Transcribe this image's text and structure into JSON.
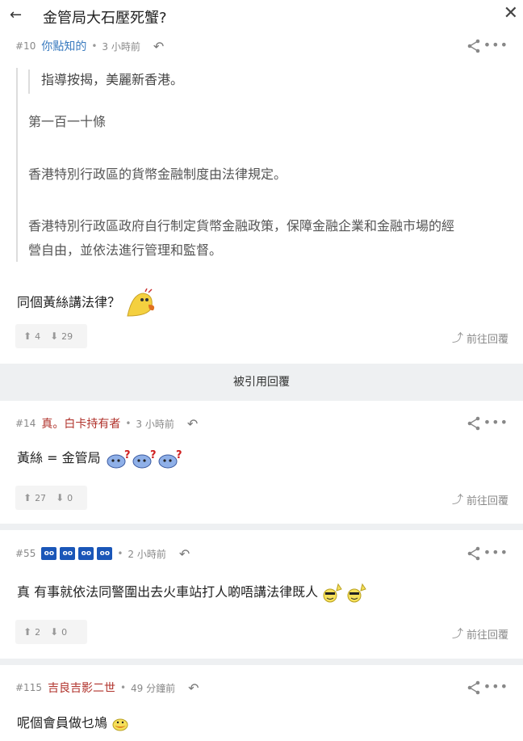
{
  "header": {
    "title": "金管局大石壓死蟹?",
    "back_icon": "arrow-left-icon",
    "close_icon": "close-icon"
  },
  "posts": [
    {
      "number": "#10",
      "user": "你點知的",
      "time": "3 小時前",
      "nested_quote": "指導按揭，美麗新香港。",
      "quote_lines": [
        "第一百一十條",
        "香港特別行政區的貨幣金融制度由法律規定。",
        "香港特別行政區政府自行制定貨幣金融政策，保障金融企業和金融市場的經",
        "營自由，並依法進行管理和監督。"
      ],
      "body": "同個黃絲講法律？",
      "up": "4",
      "down": "29",
      "goto": "前往回覆"
    },
    {
      "number": "#14",
      "user": "真。白卡持有者",
      "time": "3 小時前",
      "body": "黃絲 = 金管局",
      "up": "27",
      "down": "0",
      "goto": "前往回覆"
    },
    {
      "number": "#55",
      "user_badges": [
        "oo",
        "oo",
        "oo",
        "oo"
      ],
      "time": "2 小時前",
      "body": "真 有事就依法同警圍出去火車站打人啲唔講法律既人",
      "up": "2",
      "down": "0",
      "goto": "前往回覆"
    },
    {
      "number": "#115",
      "user": "吉良吉影二世",
      "time": "49 分鐘前",
      "body": "呢個會員做乜鳩"
    }
  ],
  "quoted_replies_label": "被引用回覆",
  "colors": {
    "blue_user": "#3a7bbf",
    "red_user": "#b0322b",
    "separator": "#eef0f2",
    "badge": "#1a56b8"
  }
}
